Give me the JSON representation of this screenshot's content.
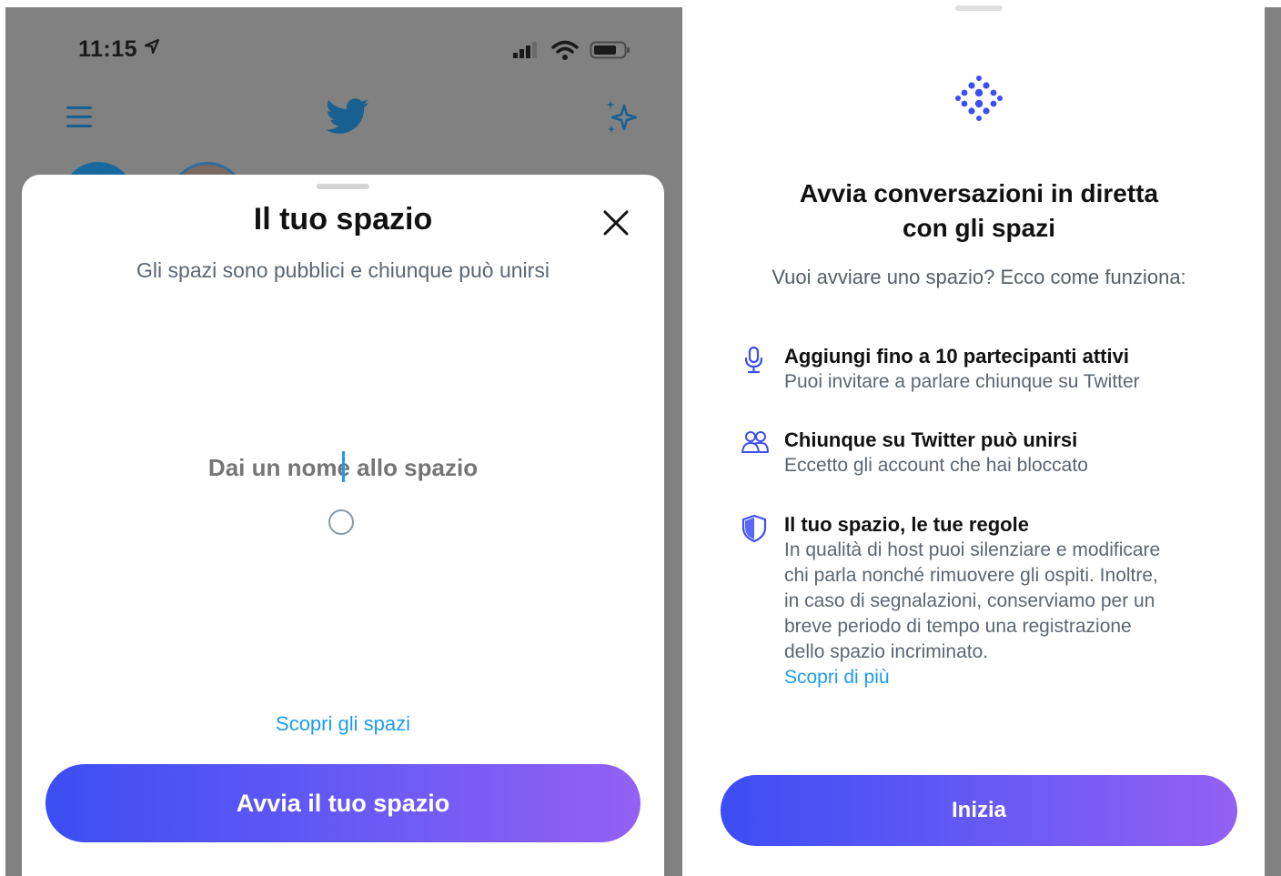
{
  "colors": {
    "accent_blue": "#1d9bf0",
    "button_gradient_start": "#3c4ef4",
    "button_gradient_end": "#9460f3",
    "overlay_gray": "#818181"
  },
  "left_screen": {
    "status_bar": {
      "time": "11:15",
      "icons": [
        "location-arrow-icon",
        "signal-icon",
        "wifi-icon",
        "battery-icon"
      ]
    },
    "nav_bar": {
      "icons": [
        "menu-icon",
        "twitter-bird-icon",
        "sparkle-icon"
      ]
    },
    "sheet": {
      "title": "Il tuo spazio",
      "subtitle": "Gli spazi sono pubblici e chiunque può unirsi",
      "name_input_placeholder": "Dai un nome allo spazio",
      "discover_link": "Scopri gli spazi",
      "start_button": "Avvia il tuo spazio"
    }
  },
  "right_screen": {
    "title_line1": "Avvia conversazioni in diretta",
    "title_line2": "con gli spazi",
    "subtitle": "Vuoi avviare uno spazio? Ecco come funziona:",
    "features": [
      {
        "icon": "microphone-icon",
        "heading": "Aggiungi fino a 10 partecipanti attivi",
        "body": [
          "Puoi invitare a parlare chiunque su Twitter"
        ]
      },
      {
        "icon": "people-icon",
        "heading": "Chiunque su Twitter può unirsi",
        "body": [
          "Eccetto gli account che hai bloccato"
        ]
      },
      {
        "icon": "shield-icon",
        "heading": "Il tuo spazio, le tue regole",
        "body": [
          "In qualità di host puoi silenziare e modificare",
          "chi parla nonché rimuovere gli ospiti. Inoltre,",
          "in caso di segnalazioni, conserviamo per un",
          "breve periodo di tempo una registrazione",
          "dello spazio incriminato."
        ],
        "link": "Scopri di più"
      }
    ],
    "start_button": "Inizia"
  }
}
